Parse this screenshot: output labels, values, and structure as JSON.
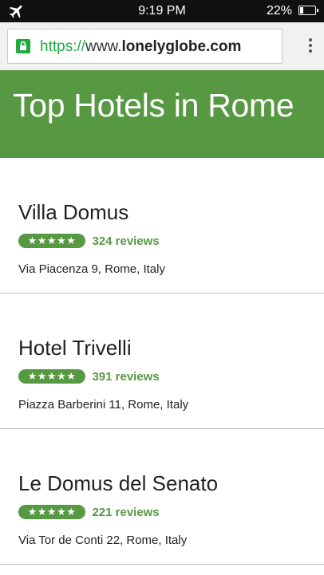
{
  "status_bar": {
    "time": "9:19 PM",
    "battery_percent": "22%",
    "battery_level": 0.22,
    "icon": "airplane-mode-icon"
  },
  "browser": {
    "url_scheme": "https://",
    "url_prefix": "www.",
    "url_host": "lonelyglobe.com",
    "secure_icon": "lock-icon",
    "menu_icon": "more-vert-icon"
  },
  "colors": {
    "accent": "#579843",
    "secure": "#1faa3e"
  },
  "page": {
    "title": "Top Hotels in Rome"
  },
  "hotels": [
    {
      "name": "Villa Domus",
      "stars": "★★★★★",
      "rating": 5,
      "reviews": "324 reviews",
      "address": "Via Piacenza 9, Rome, Italy"
    },
    {
      "name": "Hotel Trivelli",
      "stars": "★★★★★",
      "rating": 5,
      "reviews": "391 reviews",
      "address": "Piazza Barberini 11, Rome, Italy"
    },
    {
      "name": "Le Domus del Senato",
      "stars": "★★★★★",
      "rating": 5,
      "reviews": "221 reviews",
      "address": "Via Tor de Conti 22, Rome, Italy"
    }
  ]
}
